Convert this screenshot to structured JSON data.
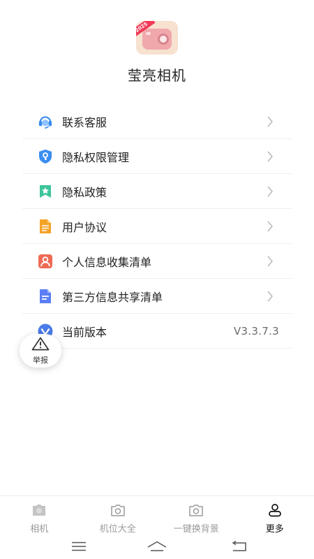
{
  "app": {
    "name": "莹亮相机",
    "logo_badge": "2025"
  },
  "menu": [
    {
      "label": "联系客服",
      "icon": "headset-icon"
    },
    {
      "label": "隐私权限管理",
      "icon": "key-shield-icon"
    },
    {
      "label": "隐私政策",
      "icon": "star-bookmark-icon"
    },
    {
      "label": "用户协议",
      "icon": "document-icon"
    },
    {
      "label": "个人信息收集清单",
      "icon": "person-card-icon"
    },
    {
      "label": "第三方信息共享清单",
      "icon": "shared-document-icon"
    },
    {
      "label": "当前版本",
      "icon": "version-icon",
      "value": "V3.3.7.3"
    }
  ],
  "report": {
    "label": "举报"
  },
  "tabs": [
    {
      "label": "相机",
      "icon": "camera-filled-icon",
      "active": false
    },
    {
      "label": "机位大全",
      "icon": "camera-outline-icon",
      "active": false
    },
    {
      "label": "一键换背景",
      "icon": "camera-outline-icon",
      "active": false
    },
    {
      "label": "更多",
      "icon": "person-icon",
      "active": true
    }
  ],
  "system_nav": [
    "menu-icon",
    "home-icon",
    "back-icon"
  ],
  "colors": {
    "headset": "#3b8df0",
    "key_shield": "#3a8ef2",
    "star_bookmark": "#3cc49a",
    "document": "#f5a327",
    "person_card": "#ef6a55",
    "shared_document": "#5b7ef5",
    "version": "#4b7be8",
    "logo_ribbon": "#ef3b57",
    "logo_bg": "#f7e1cf"
  }
}
